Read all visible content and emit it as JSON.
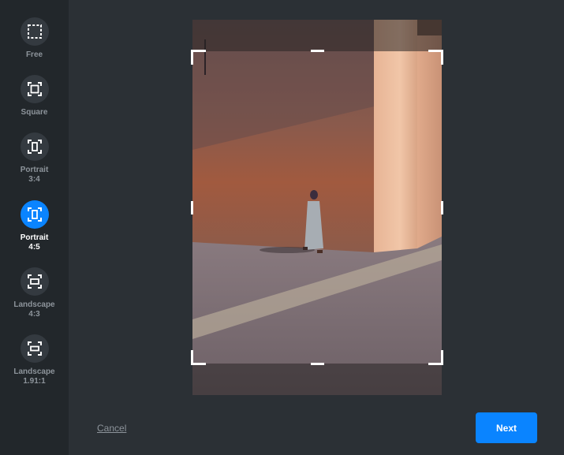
{
  "aspect_ratios": [
    {
      "label": "Free",
      "icon": "free-crop-icon",
      "active": false
    },
    {
      "label": "Square",
      "icon": "square-crop-icon",
      "active": false
    },
    {
      "label": "Portrait\n3:4",
      "icon": "portrait-crop-icon",
      "active": false
    },
    {
      "label": "Portrait\n4:5",
      "icon": "portrait-crop-icon",
      "active": true
    },
    {
      "label": "Landscape\n4:3",
      "icon": "landscape-crop-icon",
      "active": false
    },
    {
      "label": "Landscape\n1.91:1",
      "icon": "landscape-crop-icon",
      "active": false
    }
  ],
  "footer": {
    "cancel_label": "Cancel",
    "next_label": "Next"
  },
  "colors": {
    "accent": "#0a84ff",
    "background": "#2b3035",
    "sidebar": "#22272b"
  }
}
